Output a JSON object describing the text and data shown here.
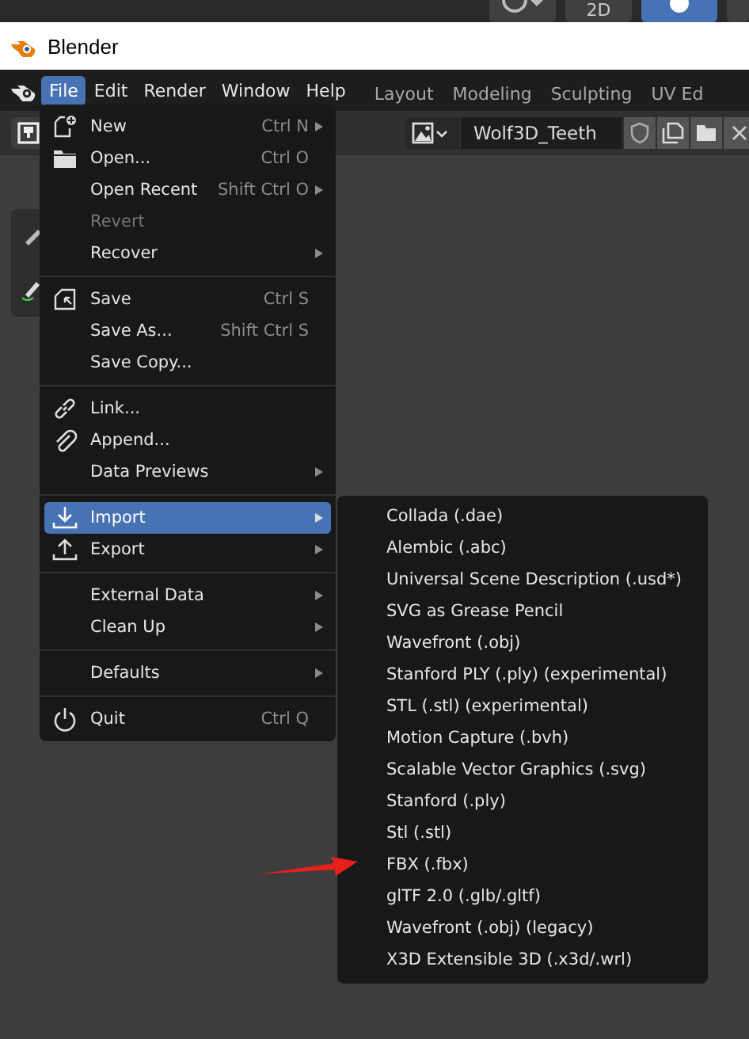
{
  "window": {
    "title": "Blender"
  },
  "top_toolbar": {
    "label": "2D"
  },
  "menu_bar": {
    "items": [
      {
        "label": "File",
        "selected": true
      },
      {
        "label": "Edit",
        "selected": false
      },
      {
        "label": "Render",
        "selected": false
      },
      {
        "label": "Window",
        "selected": false
      },
      {
        "label": "Help",
        "selected": false
      }
    ]
  },
  "workspace_tabs": [
    {
      "label": "Layout",
      "selected": false
    },
    {
      "label": "Modeling",
      "selected": false
    },
    {
      "label": "Sculpting",
      "selected": false
    },
    {
      "label": "UV Ed",
      "selected": false
    }
  ],
  "header": {
    "datablock_name": "Wolf3D_Teeth"
  },
  "file_menu": {
    "sections": [
      {
        "items": [
          {
            "label": "New",
            "shortcut": "Ctrl N",
            "submenu": true,
            "disabled": false,
            "selected": false
          },
          {
            "label": "Open...",
            "shortcut": "Ctrl O",
            "submenu": false,
            "disabled": false,
            "selected": false
          },
          {
            "label": "Open Recent",
            "shortcut": "Shift Ctrl O",
            "submenu": true,
            "disabled": false,
            "selected": false
          },
          {
            "label": "Revert",
            "submenu": false,
            "disabled": true,
            "selected": false
          },
          {
            "label": "Recover",
            "submenu": true,
            "disabled": false,
            "selected": false
          }
        ]
      },
      {
        "items": [
          {
            "label": "Save",
            "shortcut": "Ctrl S",
            "submenu": false,
            "disabled": false,
            "selected": false
          },
          {
            "label": "Save As...",
            "shortcut": "Shift Ctrl S",
            "submenu": false,
            "disabled": false,
            "selected": false
          },
          {
            "label": "Save Copy...",
            "submenu": false,
            "disabled": false,
            "selected": false
          }
        ]
      },
      {
        "items": [
          {
            "label": "Link...",
            "submenu": false,
            "disabled": false,
            "selected": false
          },
          {
            "label": "Append...",
            "submenu": false,
            "disabled": false,
            "selected": false
          },
          {
            "label": "Data Previews",
            "submenu": true,
            "disabled": false,
            "selected": false
          }
        ]
      },
      {
        "items": [
          {
            "label": "Import",
            "submenu": true,
            "disabled": false,
            "selected": true
          },
          {
            "label": "Export",
            "submenu": true,
            "disabled": false,
            "selected": false
          }
        ]
      },
      {
        "items": [
          {
            "label": "External Data",
            "submenu": true,
            "disabled": false,
            "selected": false
          },
          {
            "label": "Clean Up",
            "submenu": true,
            "disabled": false,
            "selected": false
          }
        ]
      },
      {
        "items": [
          {
            "label": "Defaults",
            "submenu": true,
            "disabled": false,
            "selected": false
          }
        ]
      },
      {
        "items": [
          {
            "label": "Quit",
            "shortcut": "Ctrl Q",
            "submenu": false,
            "disabled": false,
            "selected": false
          }
        ]
      }
    ]
  },
  "import_submenu": {
    "items": [
      {
        "label": "Collada (.dae)"
      },
      {
        "label": "Alembic (.abc)"
      },
      {
        "label": "Universal Scene Description (.usd*)"
      },
      {
        "label": "SVG as Grease Pencil"
      },
      {
        "label": "Wavefront (.obj)"
      },
      {
        "label": "Stanford PLY (.ply) (experimental)"
      },
      {
        "label": "STL (.stl) (experimental)"
      },
      {
        "label": "Motion Capture (.bvh)"
      },
      {
        "label": "Scalable Vector Graphics (.svg)"
      },
      {
        "label": "Stanford (.ply)"
      },
      {
        "label": "Stl (.stl)"
      },
      {
        "label": "FBX (.fbx)"
      },
      {
        "label": "glTF 2.0 (.glb/.gltf)"
      },
      {
        "label": "Wavefront (.obj) (legacy)"
      },
      {
        "label": "X3D Extensible 3D (.x3d/.wrl)"
      }
    ]
  }
}
